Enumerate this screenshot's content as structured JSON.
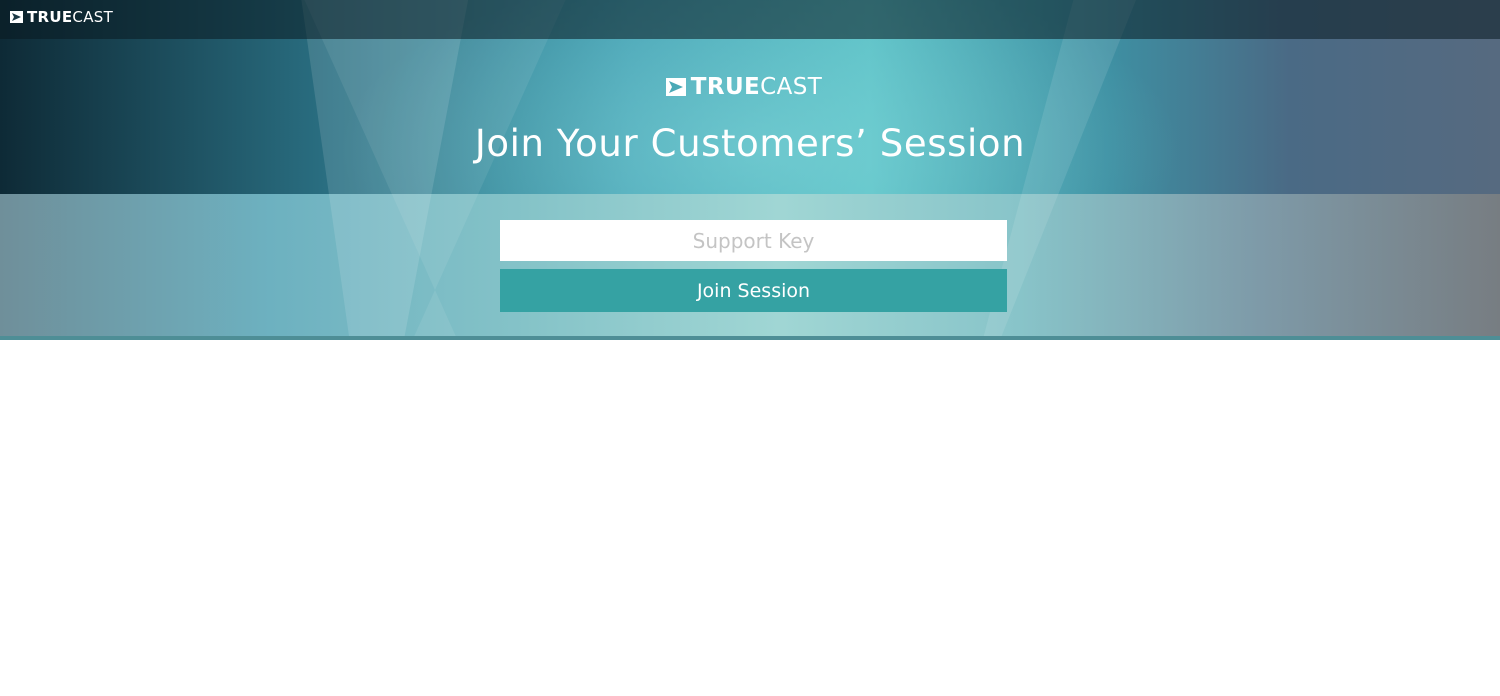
{
  "topbar": {
    "brand_bold": "TRUE",
    "brand_light": "CAST",
    "logo_icon": "play-box-icon"
  },
  "hero": {
    "brand_bold": "TRUE",
    "brand_light": "CAST",
    "headline": "Join Your Customers’ Session"
  },
  "form": {
    "support_key_placeholder": "Support Key",
    "support_key_value": "",
    "join_label": "Join Session"
  },
  "colors": {
    "accent_button": "#35a2a3",
    "text_on_hero": "#ffffff",
    "placeholder": "#c4c4c4"
  }
}
